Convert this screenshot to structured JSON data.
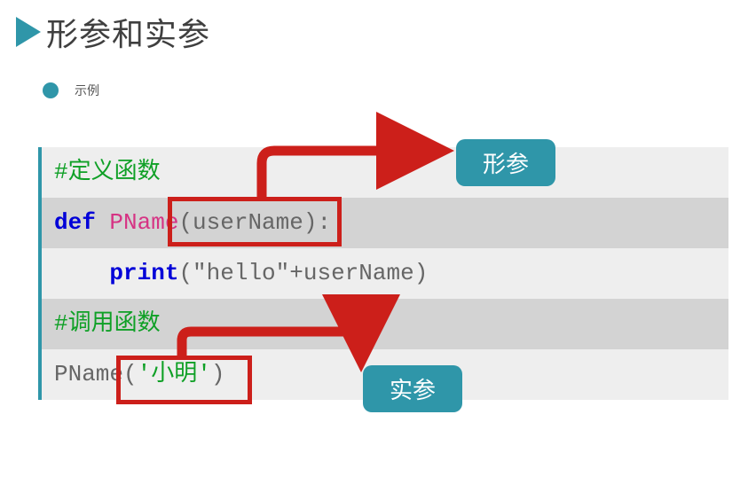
{
  "title": "形参和实参",
  "subtitle": "示例",
  "labels": {
    "formal": "形参",
    "actual": "实参"
  },
  "code": {
    "comment_define": "#定义函数",
    "kw_def": "def ",
    "fn_name": "PName",
    "open_paren": "(",
    "param": "userName",
    "close_paren": ")",
    "colon": ":",
    "indent": "    ",
    "print_kw": "print",
    "print_open": "(",
    "str_hello": "\"hello\"",
    "plus": "+",
    "var_user": "userName",
    "print_close": ")",
    "comment_call": "#调用函数",
    "call_fn": "PName",
    "call_open": "(",
    "call_arg": "'小明'",
    "call_close": ")"
  }
}
